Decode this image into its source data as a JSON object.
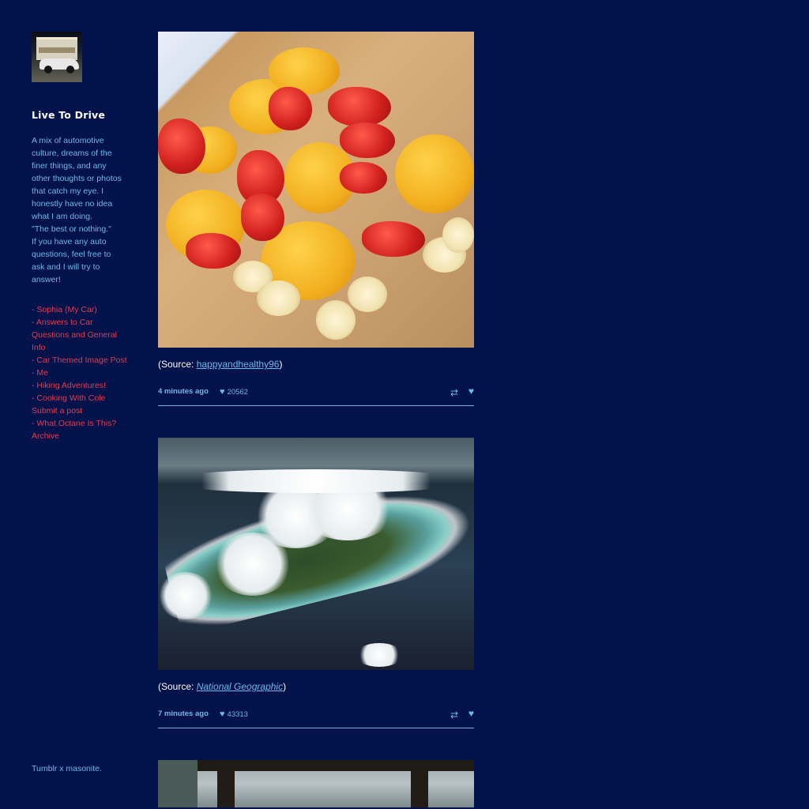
{
  "sidebar": {
    "title": "Live To Drive",
    "description": "A mix of automotive\nculture, dreams of the\nfiner things, and any\nother thoughts or photos\nthat catch my eye. I\nhonestly have no idea\nwhat I am doing.\n\"The best or nothing.\"\nIf you have any auto\nquestions, feel free to\nask and I will try to\nanswer!",
    "links": [
      "- Sophia (My Car)",
      "- Answers to Car Questions and General Info",
      "- Car Themed Image Post",
      "- Me",
      "- Hiking Adventures!",
      "- Cooking With Cole",
      "Submit a post",
      "- What Octane Is This?",
      "Archive"
    ],
    "footer": "Tumblr x masonite."
  },
  "posts": [
    {
      "source_prefix": "(Source: ",
      "source_name": "happyandhealthy96",
      "source_suffix": ")",
      "time": "4 minutes ago",
      "notes": "20562"
    },
    {
      "source_prefix": "(Source: ",
      "source_name": "National Geographic",
      "source_suffix": ")",
      "time": "7 minutes ago",
      "notes": "43313"
    }
  ],
  "colors": {
    "background": "#02124a",
    "text_blue": "#6fb8e8",
    "link_red": "#e83a4e"
  },
  "icons": {
    "notes": "heart-icon",
    "reblog": "reblog-icon",
    "like": "heart-icon"
  }
}
